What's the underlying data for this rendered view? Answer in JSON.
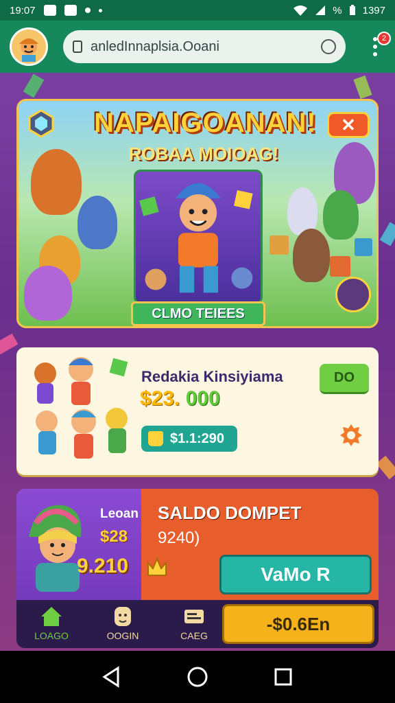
{
  "status_bar": {
    "time": "19:07",
    "battery": "1397",
    "signal_label": "%"
  },
  "browser": {
    "url": "anledInnaplsia.Ooani",
    "notification_count": "2"
  },
  "banner": {
    "title": "NAPAIGOANAN!",
    "subtitle": "ROBAA MOIOAG!",
    "cta_label": "CLMO TEIEES",
    "close_label": "✕"
  },
  "offer_card": {
    "title": "Redakia Kinsiyiama",
    "amount_prefix": "$23.",
    "amount_suffix": "000",
    "go_label": "DO",
    "balance": "$1.1:290"
  },
  "wallet_card": {
    "label": "Leoan",
    "value_small": "$28",
    "value_large": "9.210",
    "title": "SALDO DOMPET",
    "subtitle": "9240)",
    "play_label": "VaMo R",
    "withdraw_label": "-$0.6En"
  },
  "bottom_nav": {
    "items": [
      {
        "label": "LOAGO",
        "icon": "home-icon",
        "color": "#6fce42"
      },
      {
        "label": "OOGIN",
        "icon": "face-icon",
        "color": "#f3d9a3"
      },
      {
        "label": "CAEG",
        "icon": "card-icon",
        "color": "#f3d9a3"
      }
    ]
  },
  "colors": {
    "accent_green": "#16895c",
    "status_green": "#0f6b47",
    "card_orange": "#e85d2c",
    "teal": "#25b6a6",
    "gold": "#f6b21a"
  }
}
